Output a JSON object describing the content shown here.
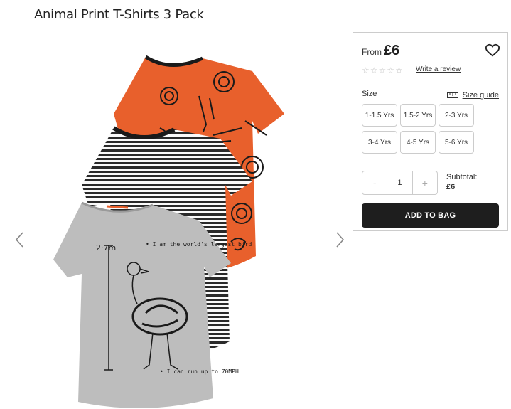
{
  "product": {
    "title": "Animal Print T-Shirts 3 Pack"
  },
  "pricing": {
    "from_label": "From",
    "price": "£6"
  },
  "reviews": {
    "rating_stars": 0,
    "max_stars": 5,
    "write_review_label": "Write a review"
  },
  "size": {
    "label": "Size",
    "guide_label": "Size guide",
    "options": [
      "1-1.5 Yrs",
      "1.5-2 Yrs",
      "2-3 Yrs",
      "3-4 Yrs",
      "4-5 Yrs",
      "5-6 Yrs"
    ]
  },
  "quantity": {
    "minus": "-",
    "value": "1",
    "plus": "+"
  },
  "subtotal": {
    "label": "Subtotal:",
    "amount": "£6"
  },
  "actions": {
    "add_to_bag": "ADD TO BAG"
  },
  "shirt_prints": {
    "measure": "2·7m",
    "note_top": "• I am the world's largest bird",
    "note_bottom": "• I can run up to 70MPH"
  },
  "colors": {
    "orange": "#e8602c",
    "grey": "#bdbdbd",
    "button": "#1e1e1e"
  }
}
